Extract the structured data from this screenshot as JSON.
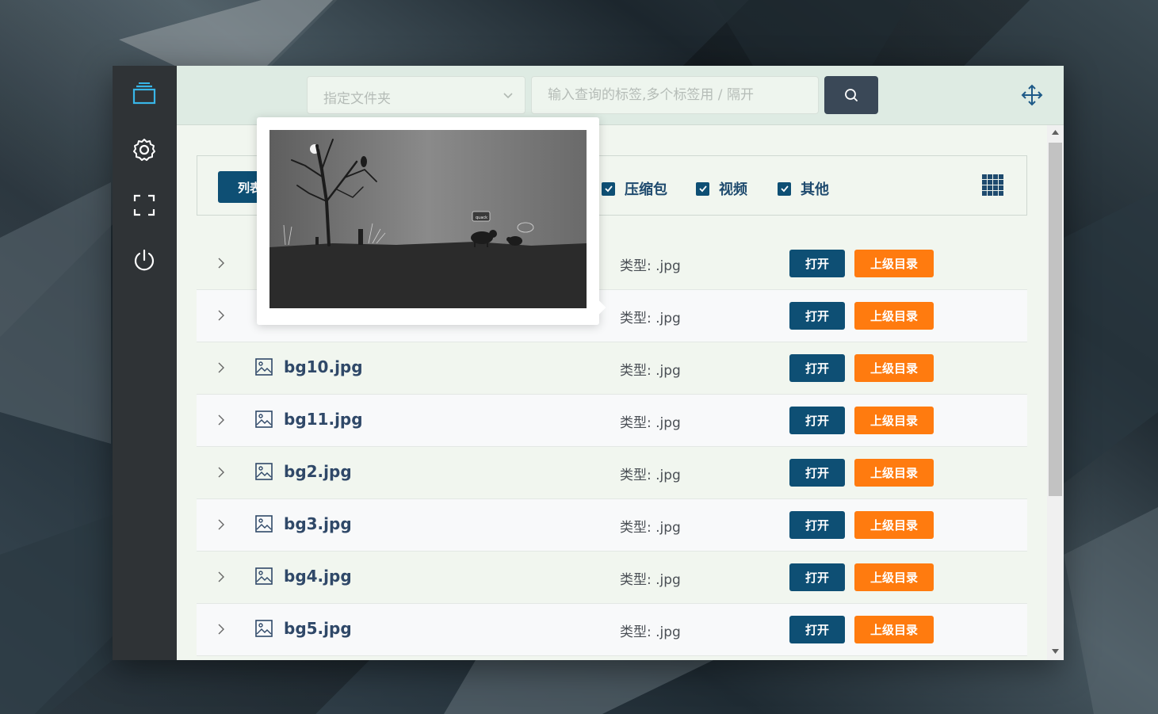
{
  "toolbar": {
    "folder_placeholder": "指定文件夹",
    "tag_placeholder": "输入查询的标签,多个标签用 / 隔开"
  },
  "filters": {
    "list_label": "列表",
    "checkboxes": [
      {
        "label": "压缩包",
        "checked": true
      },
      {
        "label": "视频",
        "checked": true
      },
      {
        "label": "其他",
        "checked": true
      }
    ]
  },
  "files": [
    {
      "name": "",
      "type": "类型: .jpg",
      "open": "打开",
      "parent": "上级目录"
    },
    {
      "name": "",
      "type": "类型: .jpg",
      "open": "打开",
      "parent": "上级目录"
    },
    {
      "name": "bg10.jpg",
      "type": "类型: .jpg",
      "open": "打开",
      "parent": "上级目录"
    },
    {
      "name": "bg11.jpg",
      "type": "类型: .jpg",
      "open": "打开",
      "parent": "上级目录"
    },
    {
      "name": "bg2.jpg",
      "type": "类型: .jpg",
      "open": "打开",
      "parent": "上级目录"
    },
    {
      "name": "bg3.jpg",
      "type": "类型: .jpg",
      "open": "打开",
      "parent": "上级目录"
    },
    {
      "name": "bg4.jpg",
      "type": "类型: .jpg",
      "open": "打开",
      "parent": "上级目录"
    },
    {
      "name": "bg5.jpg",
      "type": "类型: .jpg",
      "open": "打开",
      "parent": "上级目录"
    }
  ],
  "preview": {
    "speech_text": "quack"
  },
  "icons": {
    "sidebar": [
      "layers-icon",
      "gear-icon",
      "fullscreen-icon",
      "power-icon"
    ],
    "search": "search-icon",
    "move": "move-icon",
    "grid": "grid-view-icon",
    "file": "image-file-icon"
  },
  "colors": {
    "primary": "#0e4f74",
    "accent": "#ff7b0f",
    "sidebar": "#2f3336",
    "active_icon": "#38b6e8"
  }
}
